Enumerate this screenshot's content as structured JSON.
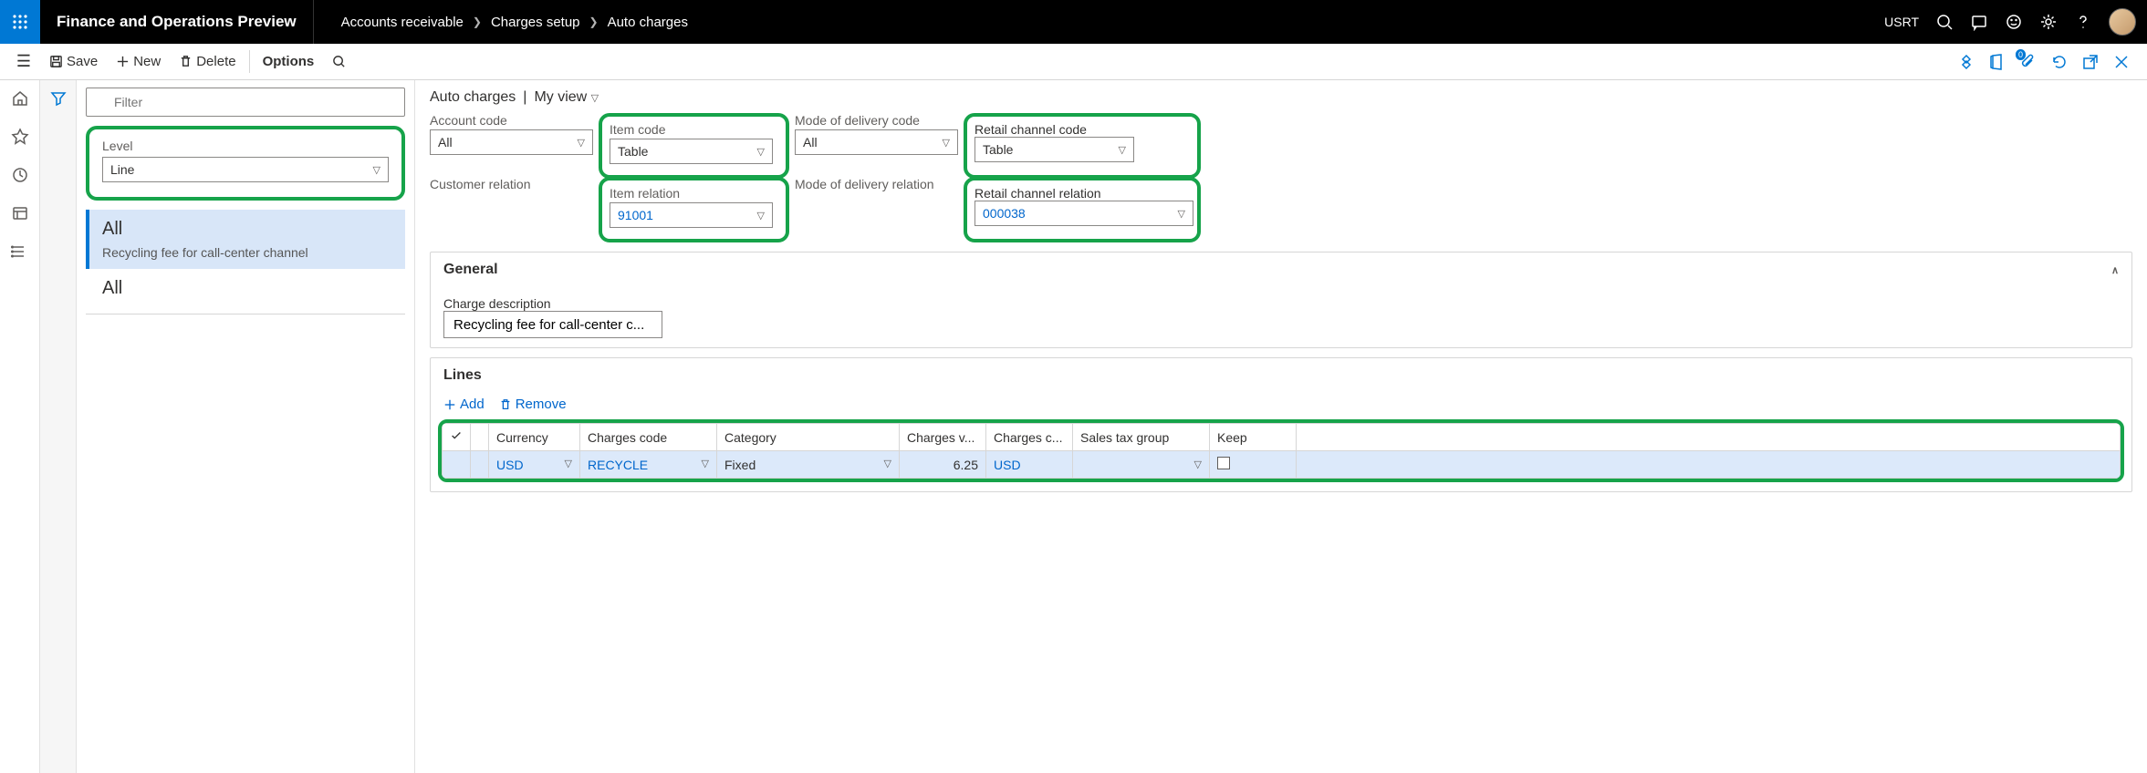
{
  "titlebar": {
    "app": "Finance and Operations Preview",
    "breadcrumb": [
      "Accounts receivable",
      "Charges setup",
      "Auto charges"
    ],
    "company": "USRT"
  },
  "toolbar": {
    "save": "Save",
    "new": "New",
    "delete": "Delete",
    "options": "Options"
  },
  "side": {
    "filter_placeholder": "Filter",
    "level_label": "Level",
    "level_value": "Line",
    "items": [
      {
        "primary": "All",
        "secondary": "Recycling fee for call-center channel",
        "selected": true
      },
      {
        "primary": "All",
        "secondary": "",
        "selected": false
      }
    ]
  },
  "main": {
    "title": "Auto charges",
    "view": "My view",
    "fields": {
      "account_code": {
        "label": "Account code",
        "value": "All"
      },
      "item_code": {
        "label": "Item code",
        "value": "Table"
      },
      "delivery_code": {
        "label": "Mode of delivery code",
        "value": "All"
      },
      "channel_code": {
        "label": "Retail channel code",
        "value": "Table"
      },
      "customer_relation": {
        "label": "Customer relation",
        "value": ""
      },
      "item_relation": {
        "label": "Item relation",
        "value": "91001"
      },
      "delivery_relation": {
        "label": "Mode of delivery relation",
        "value": ""
      },
      "channel_relation": {
        "label": "Retail channel relation",
        "value": "000038"
      }
    },
    "general": {
      "title": "General",
      "charge_desc_label": "Charge description",
      "charge_desc_value": "Recycling fee for call-center c..."
    },
    "lines": {
      "title": "Lines",
      "add": "Add",
      "remove": "Remove",
      "columns": [
        "",
        "",
        "Currency",
        "Charges code",
        "Category",
        "Charges v...",
        "Charges c...",
        "Sales tax group",
        "Keep",
        ""
      ],
      "rows": [
        {
          "currency": "USD",
          "code": "RECYCLE",
          "category": "Fixed",
          "value": "6.25",
          "charges_c": "USD",
          "tax": "",
          "keep": false
        }
      ]
    }
  }
}
